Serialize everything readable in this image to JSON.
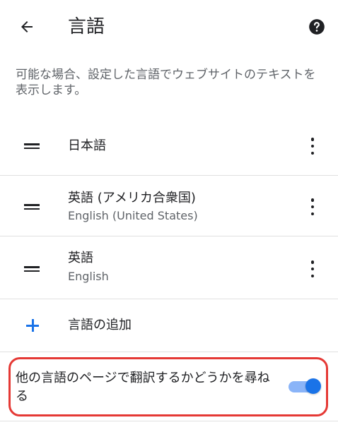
{
  "header": {
    "title": "言語",
    "back_icon": "arrow-left-icon",
    "help_icon": "help-circle-icon"
  },
  "description": "可能な場合、設定した言語でウェブサイトのテキストを表示します。",
  "languages": [
    {
      "name": "日本語",
      "sub": ""
    },
    {
      "name": "英語 (アメリカ合衆国)",
      "sub": "English (United States)"
    },
    {
      "name": "英語",
      "sub": "English"
    }
  ],
  "add_language": {
    "label": "言語の追加"
  },
  "translate": {
    "label": "他の言語のページで翻訳するかどうかを尋ねる",
    "enabled": true
  },
  "colors": {
    "accent": "#1a73e8",
    "highlight": "#e53935"
  }
}
